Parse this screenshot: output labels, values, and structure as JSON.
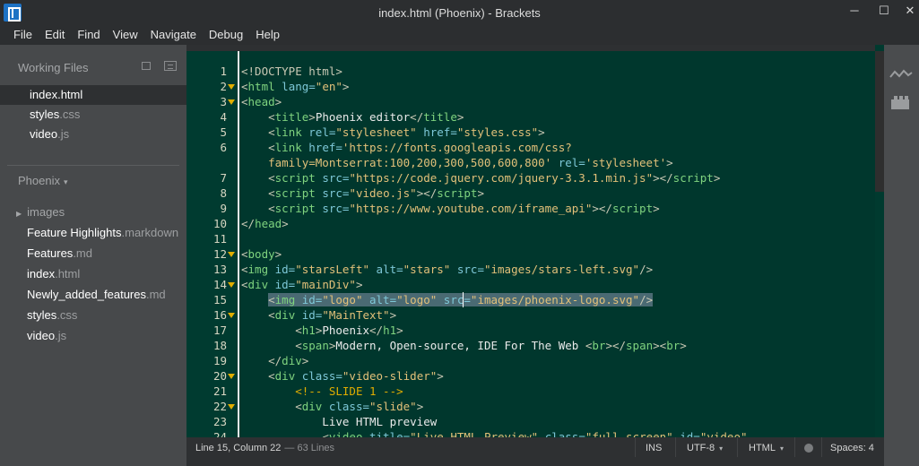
{
  "window": {
    "title": "index.html (Phoenix) - Brackets",
    "controls": {
      "minimize": "─",
      "maximize": "☐",
      "close": "✕"
    }
  },
  "menu": [
    "File",
    "Edit",
    "Find",
    "View",
    "Navigate",
    "Debug",
    "Help"
  ],
  "sidebar": {
    "working_files_header": "Working Files",
    "working_files": [
      {
        "name": "index",
        "ext": ".html",
        "selected": true
      },
      {
        "name": "styles",
        "ext": ".css",
        "selected": false
      },
      {
        "name": "video",
        "ext": ".js",
        "selected": false
      }
    ],
    "project_name": "Phoenix",
    "project_caret": "▾",
    "folder": {
      "name": "images",
      "arrow": "▶"
    },
    "tree": [
      {
        "name": "Feature Highlights",
        "ext": ".markdown"
      },
      {
        "name": "Features",
        "ext": ".md"
      },
      {
        "name": "index",
        "ext": ".html"
      },
      {
        "name": "Newly_added_features",
        "ext": ".md"
      },
      {
        "name": "styles",
        "ext": ".css"
      },
      {
        "name": "video",
        "ext": ".js"
      }
    ]
  },
  "editor": {
    "fold_lines": [
      "2",
      "3",
      "12",
      "14",
      "16",
      "20",
      "22"
    ],
    "lines": [
      {
        "n": "1",
        "parts": [
          [
            "t",
            "<!DOCTYPE html>"
          ]
        ]
      },
      {
        "n": "2",
        "parts": [
          [
            "t",
            "<"
          ],
          [
            "tg",
            "html"
          ],
          [
            "at",
            " lang="
          ],
          [
            "st",
            "\"en\""
          ],
          [
            "t",
            ">"
          ]
        ]
      },
      {
        "n": "3",
        "parts": [
          [
            "t",
            "<"
          ],
          [
            "tg",
            "head"
          ],
          [
            "t",
            ">"
          ]
        ]
      },
      {
        "n": "4",
        "parts": [
          [
            "tx",
            "    "
          ],
          [
            "t",
            "<"
          ],
          [
            "tg",
            "title"
          ],
          [
            "t",
            ">"
          ],
          [
            "tx",
            "Phoenix editor"
          ],
          [
            "t",
            "</"
          ],
          [
            "tg",
            "title"
          ],
          [
            "t",
            ">"
          ]
        ]
      },
      {
        "n": "5",
        "parts": [
          [
            "tx",
            "    "
          ],
          [
            "t",
            "<"
          ],
          [
            "tg",
            "link"
          ],
          [
            "at",
            " rel="
          ],
          [
            "st",
            "\"stylesheet\""
          ],
          [
            "at",
            " href="
          ],
          [
            "st",
            "\"styles.css\""
          ],
          [
            "t",
            ">"
          ]
        ]
      },
      {
        "n": "6",
        "parts": [
          [
            "tx",
            "    "
          ],
          [
            "t",
            "<"
          ],
          [
            "tg",
            "link"
          ],
          [
            "at",
            " href="
          ],
          [
            "st",
            "'https://fonts.googleapis.com/css?"
          ]
        ]
      },
      {
        "n": "",
        "parts": [
          [
            "st",
            "    family=Montserrat:100,200,300,500,600,800'"
          ],
          [
            "at",
            " rel="
          ],
          [
            "st",
            "'stylesheet'"
          ],
          [
            "t",
            ">"
          ]
        ]
      },
      {
        "n": "7",
        "parts": [
          [
            "tx",
            "    "
          ],
          [
            "t",
            "<"
          ],
          [
            "tg",
            "script"
          ],
          [
            "at",
            " src="
          ],
          [
            "st",
            "\"https://code.jquery.com/jquery-3.3.1.min.js\""
          ],
          [
            "t",
            "></"
          ],
          [
            "tg",
            "script"
          ],
          [
            "t",
            ">"
          ]
        ]
      },
      {
        "n": "8",
        "parts": [
          [
            "tx",
            "    "
          ],
          [
            "t",
            "<"
          ],
          [
            "tg",
            "script"
          ],
          [
            "at",
            " src="
          ],
          [
            "st",
            "\"video.js\""
          ],
          [
            "t",
            "></"
          ],
          [
            "tg",
            "script"
          ],
          [
            "t",
            ">"
          ]
        ]
      },
      {
        "n": "9",
        "parts": [
          [
            "tx",
            "    "
          ],
          [
            "t",
            "<"
          ],
          [
            "tg",
            "script"
          ],
          [
            "at",
            " src="
          ],
          [
            "st",
            "\"https://www.youtube.com/iframe_api\""
          ],
          [
            "t",
            "></"
          ],
          [
            "tg",
            "script"
          ],
          [
            "t",
            ">"
          ]
        ]
      },
      {
        "n": "10",
        "parts": [
          [
            "t",
            "</"
          ],
          [
            "tg",
            "head"
          ],
          [
            "t",
            ">"
          ]
        ]
      },
      {
        "n": "11",
        "parts": []
      },
      {
        "n": "12",
        "parts": [
          [
            "t",
            "<"
          ],
          [
            "tg",
            "body"
          ],
          [
            "t",
            ">"
          ]
        ]
      },
      {
        "n": "13",
        "parts": [
          [
            "t",
            "<"
          ],
          [
            "tg",
            "img"
          ],
          [
            "at",
            " id="
          ],
          [
            "st",
            "\"starsLeft\""
          ],
          [
            "at",
            " alt="
          ],
          [
            "st",
            "\"stars\""
          ],
          [
            "at",
            " src="
          ],
          [
            "st",
            "\"images/stars-left.svg\""
          ],
          [
            "t",
            "/>"
          ]
        ]
      },
      {
        "n": "14",
        "parts": [
          [
            "t",
            "<"
          ],
          [
            "tg",
            "div"
          ],
          [
            "at",
            " id="
          ],
          [
            "st",
            "\"mainDiv\""
          ],
          [
            "t",
            ">"
          ]
        ]
      },
      {
        "n": "15",
        "selected": true,
        "parts": [
          [
            "tx",
            "    "
          ],
          [
            "t",
            "<"
          ],
          [
            "tg",
            "img"
          ],
          [
            "at",
            " id="
          ],
          [
            "st",
            "\"logo\""
          ],
          [
            "at",
            " alt="
          ],
          [
            "st",
            "\"logo\""
          ],
          [
            "at",
            " src="
          ],
          [
            "st",
            "\"images/phoenix-logo.svg\""
          ],
          [
            "t",
            "/>"
          ]
        ]
      },
      {
        "n": "16",
        "parts": [
          [
            "tx",
            "    "
          ],
          [
            "t",
            "<"
          ],
          [
            "tg",
            "div"
          ],
          [
            "at",
            " id="
          ],
          [
            "st",
            "\"MainText\""
          ],
          [
            "t",
            ">"
          ]
        ]
      },
      {
        "n": "17",
        "parts": [
          [
            "tx",
            "        "
          ],
          [
            "t",
            "<"
          ],
          [
            "tg",
            "h1"
          ],
          [
            "t",
            ">"
          ],
          [
            "tx",
            "Phoenix"
          ],
          [
            "t",
            "</"
          ],
          [
            "tg",
            "h1"
          ],
          [
            "t",
            ">"
          ]
        ]
      },
      {
        "n": "18",
        "parts": [
          [
            "tx",
            "        "
          ],
          [
            "t",
            "<"
          ],
          [
            "tg",
            "span"
          ],
          [
            "t",
            ">"
          ],
          [
            "tx",
            "Modern, Open-source, IDE For The Web "
          ],
          [
            "t",
            "<"
          ],
          [
            "tg",
            "br"
          ],
          [
            "t",
            "></"
          ],
          [
            "tg",
            "span"
          ],
          [
            "t",
            "><"
          ],
          [
            "tg",
            "br"
          ],
          [
            "t",
            ">"
          ]
        ]
      },
      {
        "n": "19",
        "parts": [
          [
            "tx",
            "    "
          ],
          [
            "t",
            "</"
          ],
          [
            "tg",
            "div"
          ],
          [
            "t",
            ">"
          ]
        ]
      },
      {
        "n": "20",
        "parts": [
          [
            "tx",
            "    "
          ],
          [
            "t",
            "<"
          ],
          [
            "tg",
            "div"
          ],
          [
            "at",
            " class="
          ],
          [
            "st",
            "\"video-slider\""
          ],
          [
            "t",
            ">"
          ]
        ]
      },
      {
        "n": "21",
        "parts": [
          [
            "tx",
            "        "
          ],
          [
            "cm",
            "<!-- SLIDE 1 -->"
          ]
        ]
      },
      {
        "n": "22",
        "parts": [
          [
            "tx",
            "        "
          ],
          [
            "t",
            "<"
          ],
          [
            "tg",
            "div"
          ],
          [
            "at",
            " class="
          ],
          [
            "st",
            "\"slide\""
          ],
          [
            "t",
            ">"
          ]
        ]
      },
      {
        "n": "23",
        "parts": [
          [
            "tx",
            "            Live HTML preview"
          ]
        ]
      },
      {
        "n": "24",
        "parts": [
          [
            "tx",
            "            "
          ],
          [
            "t",
            "<"
          ],
          [
            "tg",
            "video"
          ],
          [
            "at",
            " title="
          ],
          [
            "st",
            "\"Live HTML Preview\""
          ],
          [
            "at",
            " class="
          ],
          [
            "st",
            "\"full-screen\""
          ],
          [
            "at",
            " id="
          ],
          [
            "st",
            "\"video\""
          ]
        ]
      }
    ]
  },
  "statusbar": {
    "position": "Line 15, Column 22",
    "lines": "— 63 Lines",
    "mode": "INS",
    "encoding": "UTF-8",
    "language": "HTML",
    "caret": "▾",
    "spaces": "Spaces: 4"
  },
  "right_toolbar": {
    "icons": [
      "live-preview-icon",
      "extension-manager-icon"
    ]
  },
  "colors": {
    "editor_bg": "#00372d",
    "gutter_bg": "#003b30",
    "sidebar_bg": "#47494b",
    "fold_marker": "#e0ad00",
    "selection": "#4a6a73"
  }
}
